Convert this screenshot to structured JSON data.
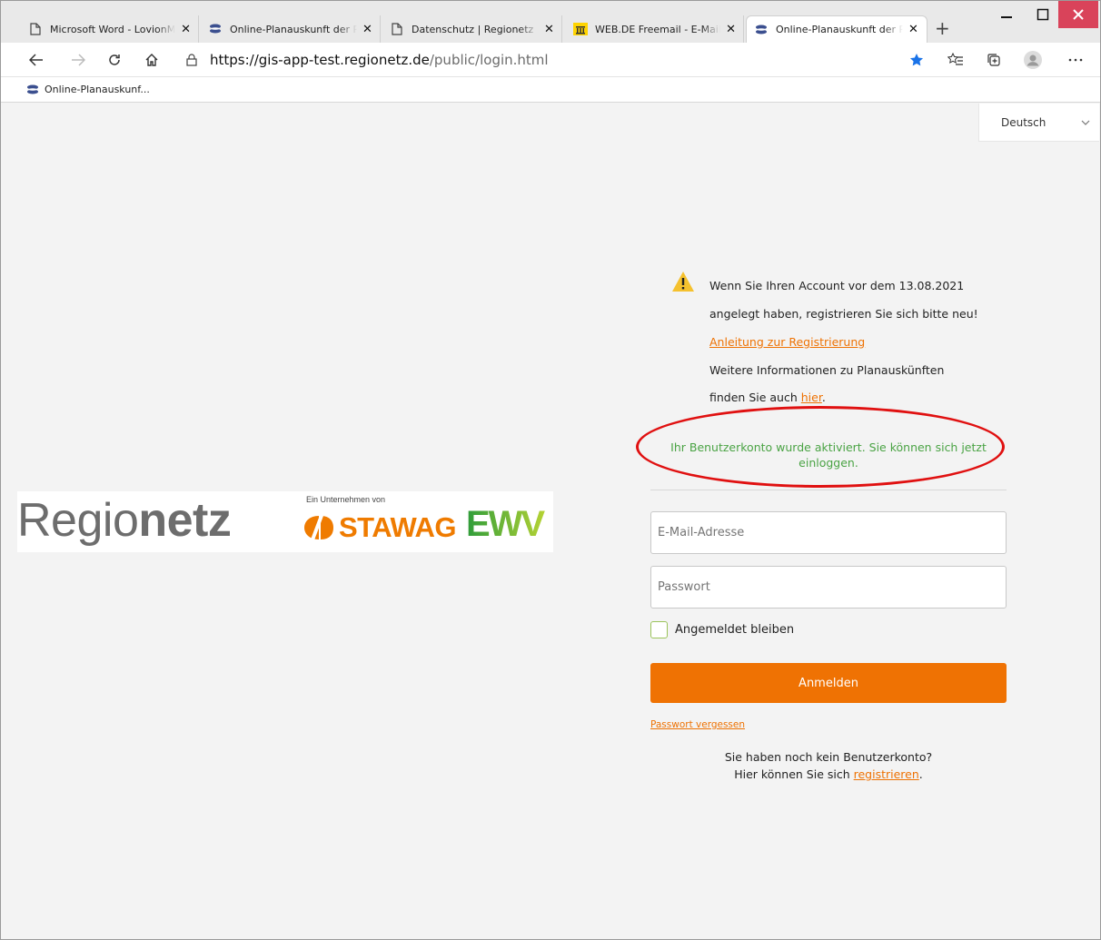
{
  "browser": {
    "tabs": [
      {
        "label": "Microsoft Word - LovionM",
        "icon": "page-icon"
      },
      {
        "label": "Online-Planauskunft der Re",
        "icon": "regionetz-icon"
      },
      {
        "label": "Datenschutz | Regionetz",
        "icon": "page-icon"
      },
      {
        "label": "WEB.DE Freemail - E-Mail",
        "icon": "webde-icon"
      },
      {
        "label": "Online-Planauskunft der Re",
        "icon": "regionetz-icon"
      }
    ],
    "active_tab": 4,
    "url_host": "https://gis-app-test.regionetz.de",
    "url_path": "/public/login.html",
    "favorite": "Online-Planauskunf...",
    "colors": {
      "close_button": "#d9435a",
      "star": "#1a73e8"
    }
  },
  "language": "Deutsch",
  "logo": {
    "regio": "Regio",
    "netz": "netz",
    "company_note": "Ein Unternehmen von",
    "stawag": "STAWAG",
    "ewv": "EWV"
  },
  "notice": {
    "line1": "Wenn Sie Ihren Account vor dem 13.08.2021",
    "line2": "angelegt haben, registrieren Sie sich bitte neu!",
    "link": "Anleitung zur Registrierung",
    "line4": "Weitere Informationen zu Planauskünften",
    "line5_prefix": "finden Sie auch ",
    "line5_link": "hier",
    "line5_suffix": "."
  },
  "activation_message": "Ihr Benutzerkonto wurde aktiviert. Sie können sich jetzt einloggen.",
  "form": {
    "email_placeholder": "E-Mail-Adresse",
    "password_placeholder": "Passwort",
    "remember_label": "Angemeldet bleiben",
    "submit_label": "Anmelden",
    "forgot_label": "Passwort vergessen",
    "no_account_line1": "Sie haben noch kein Benutzerkonto?",
    "no_account_prefix": "Hier können Sie sich ",
    "register_link": "registrieren",
    "no_account_suffix": "."
  },
  "colors": {
    "accent": "#ef7203",
    "success": "#4aa344",
    "highlight": "#e01010"
  }
}
